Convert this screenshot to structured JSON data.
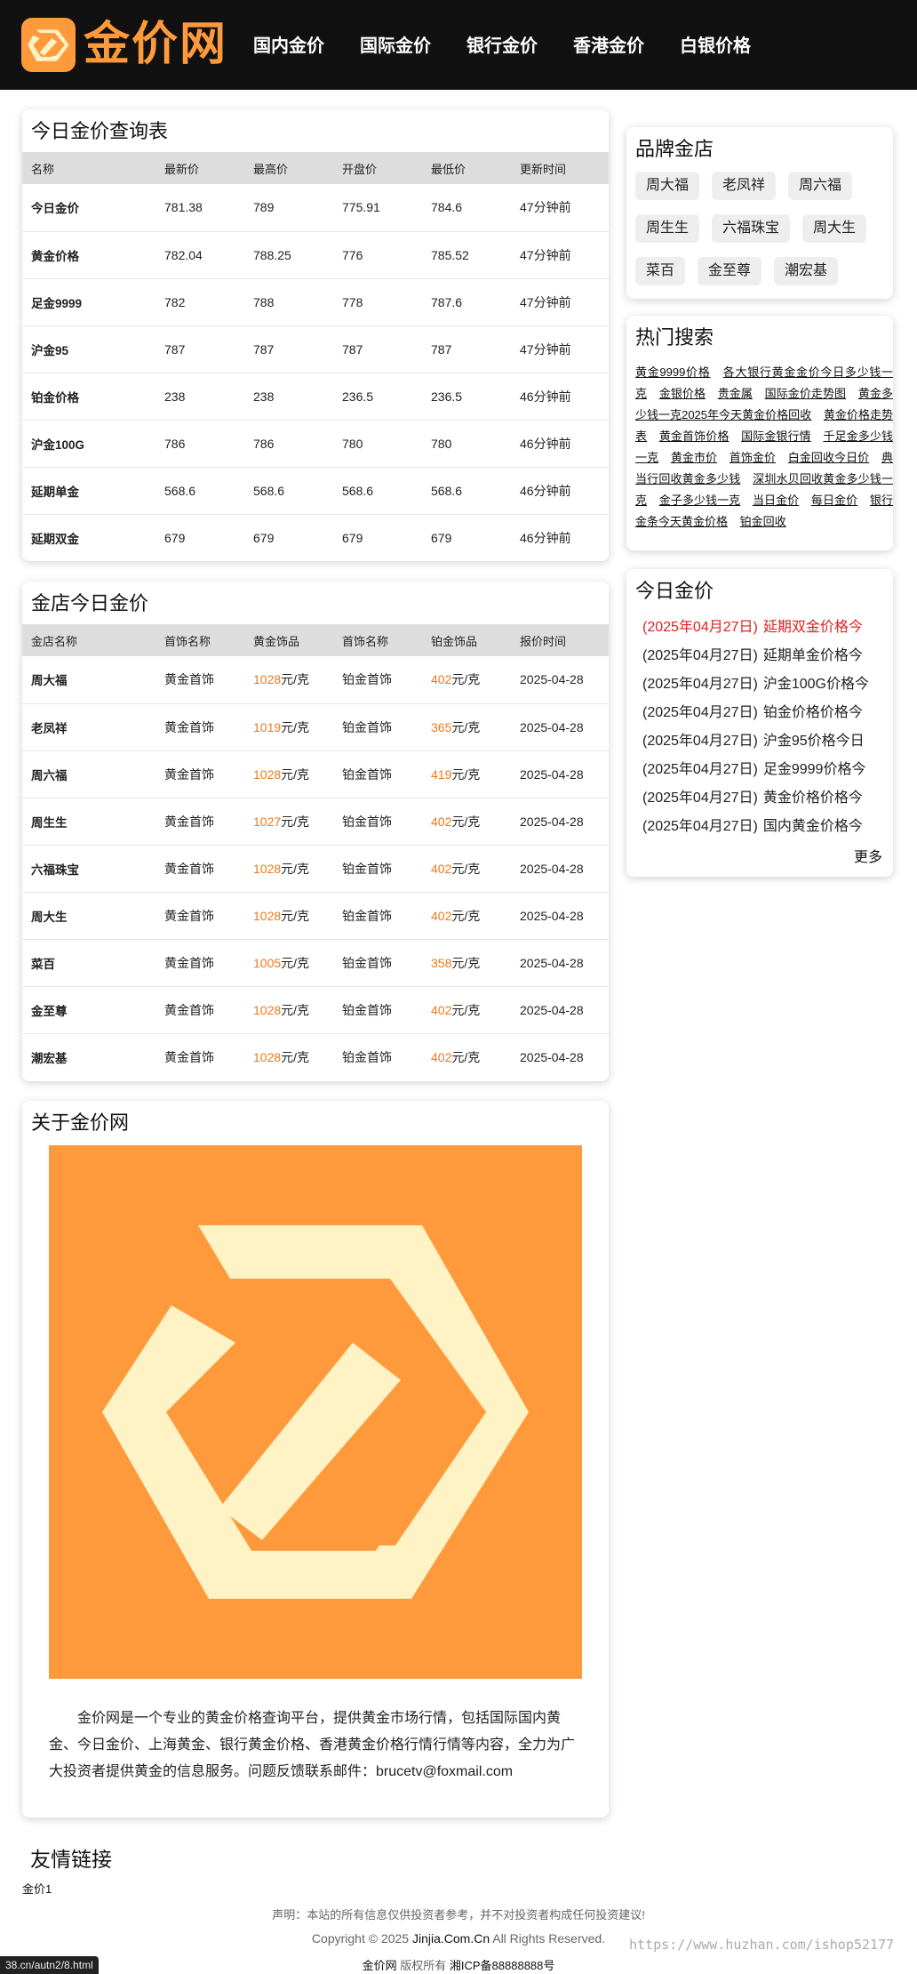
{
  "header": {
    "logo_text": "金价网",
    "nav": [
      "国内金价",
      "国际金价",
      "银行金价",
      "香港金价",
      "白银价格"
    ]
  },
  "price_table": {
    "title": "今日金价查询表",
    "columns": [
      "名称",
      "最新价",
      "最高价",
      "开盘价",
      "最低价",
      "更新时间"
    ],
    "rows": [
      [
        "今日金价",
        "781.38",
        "789",
        "775.91",
        "784.6",
        "47分钟前"
      ],
      [
        "黄金价格",
        "782.04",
        "788.25",
        "776",
        "785.52",
        "47分钟前"
      ],
      [
        "足金9999",
        "782",
        "788",
        "778",
        "787.6",
        "47分钟前"
      ],
      [
        "沪金95",
        "787",
        "787",
        "787",
        "787",
        "47分钟前"
      ],
      [
        "铂金价格",
        "238",
        "238",
        "236.5",
        "236.5",
        "46分钟前"
      ],
      [
        "沪金100G",
        "786",
        "786",
        "780",
        "780",
        "46分钟前"
      ],
      [
        "延期单金",
        "568.6",
        "568.6",
        "568.6",
        "568.6",
        "46分钟前"
      ],
      [
        "延期双金",
        "679",
        "679",
        "679",
        "679",
        "46分钟前"
      ]
    ]
  },
  "store_table": {
    "title": "金店今日金价",
    "columns": [
      "金店名称",
      "首饰名称",
      "黄金饰品",
      "首饰名称",
      "铂金饰品",
      "报价时间"
    ],
    "unit": "元/克",
    "rows": [
      [
        "周大福",
        "黄金首饰",
        "1028",
        "铂金首饰",
        "402",
        "2025-04-28"
      ],
      [
        "老凤祥",
        "黄金首饰",
        "1019",
        "铂金首饰",
        "365",
        "2025-04-28"
      ],
      [
        "周六福",
        "黄金首饰",
        "1028",
        "铂金首饰",
        "419",
        "2025-04-28"
      ],
      [
        "周生生",
        "黄金首饰",
        "1027",
        "铂金首饰",
        "402",
        "2025-04-28"
      ],
      [
        "六福珠宝",
        "黄金首饰",
        "1028",
        "铂金首饰",
        "402",
        "2025-04-28"
      ],
      [
        "周大生",
        "黄金首饰",
        "1028",
        "铂金首饰",
        "402",
        "2025-04-28"
      ],
      [
        "菜百",
        "黄金首饰",
        "1005",
        "铂金首饰",
        "358",
        "2025-04-28"
      ],
      [
        "金至尊",
        "黄金首饰",
        "1028",
        "铂金首饰",
        "402",
        "2025-04-28"
      ],
      [
        "潮宏基",
        "黄金首饰",
        "1028",
        "铂金首饰",
        "402",
        "2025-04-28"
      ]
    ]
  },
  "about": {
    "title": "关于金价网",
    "text": "金价网是一个专业的黄金价格查询平台，提供黄金市场行情，包括国际国内黄金、今日金价、上海黄金、银行黄金价格、香港黄金价格行情行情等内容，全力为广大投资者提供黄金的信息服务。问题反馈联系邮件：brucetv@foxmail.com"
  },
  "brands": {
    "title": "品牌金店",
    "items": [
      "周大福",
      "老凤祥",
      "周六福",
      "周生生",
      "六福珠宝",
      "周大生",
      "菜百",
      "金至尊",
      "潮宏基"
    ]
  },
  "hot_search": {
    "title": "热门搜索",
    "items": [
      "黄金9999价格",
      "各大银行黄金金价今日多少钱一克",
      "金银价格",
      "贵金属",
      "国际金价走势图",
      "黄金多少钱一克2025年今天黄金价格回收",
      "黄金价格走势表",
      "黄金首饰价格",
      "国际金银行情",
      "千足金多少钱一克",
      "黄金市价",
      "首饰金价",
      "白金回收今日价",
      "典当行回收黄金多少钱",
      "深圳水贝回收黄金多少钱一克",
      "金子多少钱一克",
      "当日金价",
      "每日金价",
      "银行金条今天黄金价格",
      "铂金回收"
    ]
  },
  "today_news": {
    "title": "今日金价",
    "items": [
      {
        "date": "(2025年04月27日)",
        "text": "延期双金价格今"
      },
      {
        "date": "(2025年04月27日)",
        "text": "延期单金价格今"
      },
      {
        "date": "(2025年04月27日)",
        "text": "沪金100G价格今"
      },
      {
        "date": "(2025年04月27日)",
        "text": "铂金价格价格今"
      },
      {
        "date": "(2025年04月27日)",
        "text": "沪金95价格今日"
      },
      {
        "date": "(2025年04月27日)",
        "text": "足金9999价格今"
      },
      {
        "date": "(2025年04月27日)",
        "text": "黄金价格价格今"
      },
      {
        "date": "(2025年04月27日)",
        "text": "国内黄金价格今"
      }
    ],
    "more": "更多"
  },
  "footer": {
    "links_title": "友情链接",
    "links": [
      "金价1"
    ],
    "disclaimer": "声明：本站的所有信息仅供投资者参考，并不对投资者构成任何投资建议!",
    "copyright_prefix": "Copyright © 2025",
    "copyright_site": "Jinjia.Com.Cn",
    "copyright_suffix": "All Rights Reserved.",
    "owner_name": "金价网",
    "owner_suffix": "版权所有",
    "icp": "湘ICP备88888888号",
    "status_url": "38.cn/autn2/8.html",
    "watermark": "https://www.huzhan.com/ishop52177"
  },
  "colors": {
    "brand": "#ff9a3c",
    "up": "#1a9a3a",
    "price": "#f07818",
    "highlight": "#e02020"
  }
}
